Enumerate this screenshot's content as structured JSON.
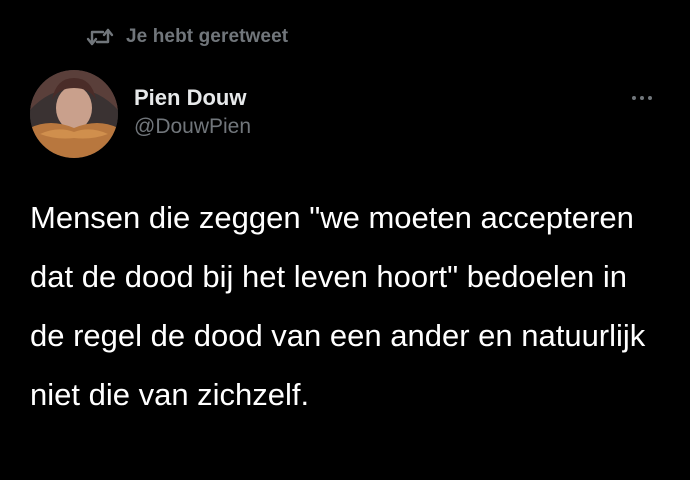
{
  "retweet": {
    "icon": "retweet-icon",
    "label": "Je hebt geretweet"
  },
  "author": {
    "name": "Pien Douw",
    "handle": "@DouwPien",
    "avatar": "avatar"
  },
  "more": {
    "icon": "more-dots-icon"
  },
  "tweet": {
    "text": "Mensen die zeggen \"we moeten accepteren dat de dood bij het leven hoort\" bedoelen in de regel de dood van een ander en natuurlijk niet die van zichzelf."
  },
  "colors": {
    "background": "#000000",
    "primary_text": "#e7e9ea",
    "secondary_text": "#71767b",
    "tweet_text": "#ffffff"
  }
}
